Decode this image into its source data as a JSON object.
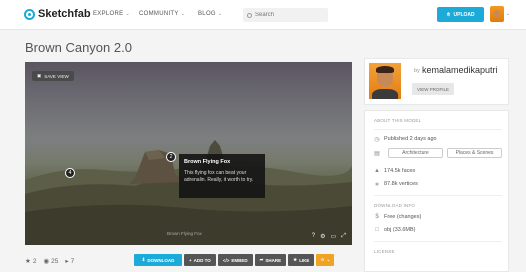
{
  "header": {
    "logo_text": "Sketchfab",
    "nav": [
      "EXPLORE",
      "COMMUNITY",
      "BLOG"
    ],
    "search_placeholder": "Search",
    "upload_label": "UPLOAD",
    "accent_color": "#1caad9"
  },
  "page": {
    "title": "Brown Canyon 2.0"
  },
  "viewer": {
    "save_view_label": "SAVE VIEW",
    "hotspots": [
      "4",
      "2"
    ],
    "annotation": {
      "title": "Brown Flying Fox",
      "text": "This flying fox can beat your adrenalin. Really, it worth to try."
    },
    "caption": "Brown Flying Fox",
    "controls": [
      "?",
      "gear",
      "vr",
      "fullscreen"
    ]
  },
  "stats": {
    "likes": "2",
    "views": "25",
    "comments": "7"
  },
  "actions": {
    "download": "DOWNLOAD",
    "add_to": "ADD TO",
    "embed": "EMBED",
    "share": "SHARE",
    "like": "LIKE",
    "more": "☆"
  },
  "author": {
    "by": "by",
    "username": "kemalamedikaputri",
    "view_profile": "VIEW PROFILE"
  },
  "model_info": {
    "section_label": "ABOUT THIS MODEL",
    "published": "Published 2 days ago",
    "categories": [
      "Architecture",
      "Places & Scenes"
    ],
    "faces": "174.5k faces",
    "vertices": "87.8k vertices"
  },
  "download_info": {
    "section_label": "DOWNLOAD INFO",
    "price": "Free (changes)",
    "file": "obj (33.6MB)"
  },
  "license": {
    "section_label": "LICENSE"
  }
}
